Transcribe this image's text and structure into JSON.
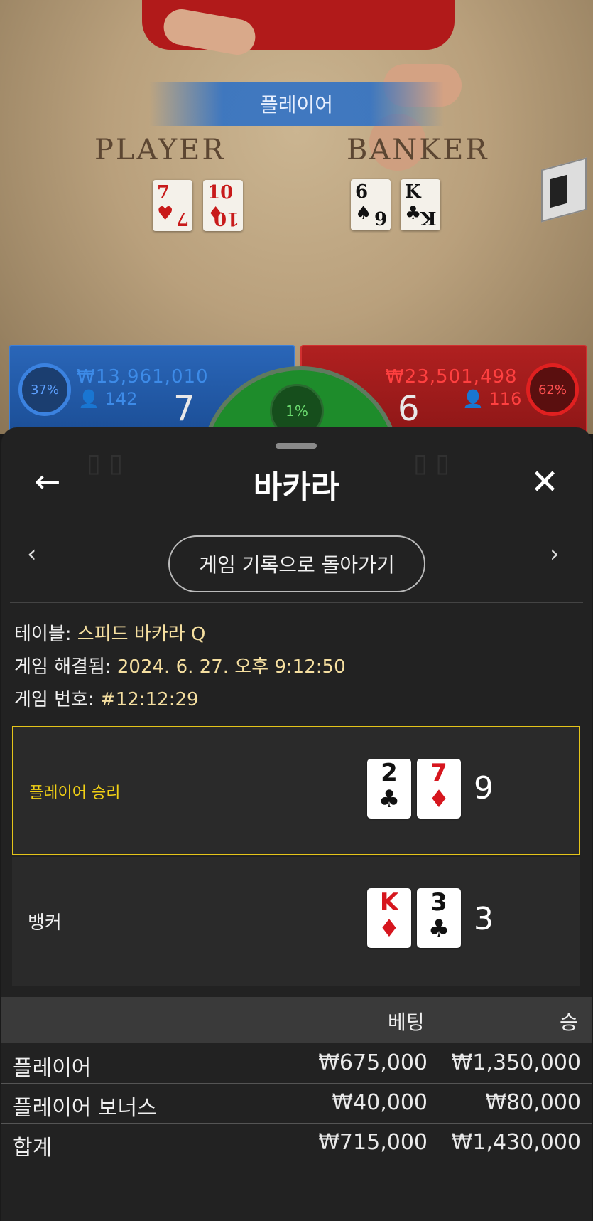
{
  "video": {
    "result_banner": "플레이어",
    "player_table_label": "PLAYER",
    "banker_table_label": "BANKER",
    "player_cards": [
      {
        "rank": "7",
        "suit": "♥",
        "color": "red"
      },
      {
        "rank": "10",
        "suit": "♦",
        "color": "red"
      }
    ],
    "banker_cards": [
      {
        "rank": "6",
        "suit": "♠",
        "color": "black"
      },
      {
        "rank": "K",
        "suit": "♣",
        "color": "black"
      }
    ]
  },
  "bet_bars": {
    "player": {
      "percent": "37%",
      "amount": "₩13,961,010",
      "count": "142",
      "total": "7",
      "color": "#2a66b8"
    },
    "banker": {
      "percent": "62%",
      "amount": "₩23,501,498",
      "count": "116",
      "total": "6",
      "color": "#b02020"
    },
    "tie": {
      "percent": "1%"
    }
  },
  "sheet": {
    "title": "바카라",
    "back_icon": "arrow-left-icon",
    "close_icon": "close-icon",
    "back_to_history_label": "게임 기록으로 돌아가기",
    "info": {
      "table_label": "테이블:",
      "table_value": "스피드 바카라 Q",
      "resolved_label": "게임 해결됨:",
      "resolved_value": "2024. 6. 27. 오후 9:12:50",
      "number_label": "게임 번호:",
      "number_value": "#12:12:29"
    },
    "results": {
      "player": {
        "label": "플레이어 승리",
        "cards": [
          {
            "rank": "2",
            "suit": "♣",
            "color": "black"
          },
          {
            "rank": "7",
            "suit": "♦",
            "color": "red"
          }
        ],
        "score": "9",
        "highlight_color": "#e4c41a"
      },
      "banker": {
        "label": "뱅커",
        "cards": [
          {
            "rank": "K",
            "suit": "♦",
            "color": "red"
          },
          {
            "rank": "3",
            "suit": "♣",
            "color": "black"
          }
        ],
        "score": "3"
      }
    },
    "bets_table": {
      "headers": {
        "bet": "베팅",
        "win": "승"
      },
      "rows": [
        {
          "name": "플레이어",
          "bet": "₩675,000",
          "win": "₩1,350,000"
        },
        {
          "name": "플레이어 보너스",
          "bet": "₩40,000",
          "win": "₩80,000"
        },
        {
          "name": "합계",
          "bet": "₩715,000",
          "win": "₩1,430,000"
        }
      ]
    }
  }
}
